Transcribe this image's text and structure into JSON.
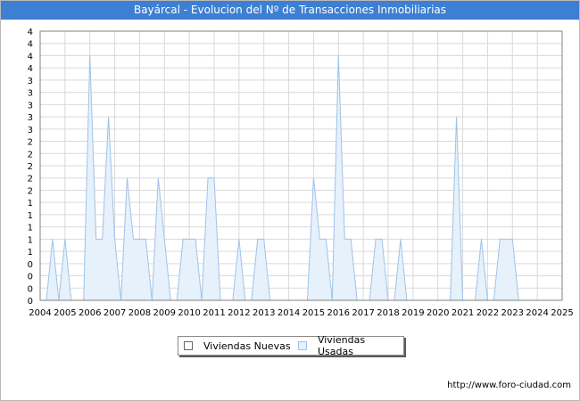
{
  "header": {
    "title": "Bayárcal - Evolucion del Nº de Transacciones Inmobiliarias"
  },
  "footer": {
    "url": "http://www.foro-ciudad.com"
  },
  "colors": {
    "title_bar": "#3d7fd3",
    "new_fill": "#ffffff",
    "used_fill": "#e6f1fb",
    "used_stroke": "#9ec3ea"
  },
  "chart_data": {
    "type": "area",
    "title": "Bayárcal - Evolucion del Nº de Transacciones Inmobiliarias",
    "xlabel": "",
    "ylabel": "",
    "x_ticks": [
      "2004",
      "2005",
      "2006",
      "2007",
      "2008",
      "2009",
      "2010",
      "2011",
      "2012",
      "2013",
      "2014",
      "2015",
      "2016",
      "2017",
      "2018",
      "2019",
      "2020",
      "2021",
      "2022",
      "2023",
      "2024",
      "2025"
    ],
    "y_tick_labels": [
      "0",
      "0",
      "0",
      "0",
      "1",
      "1",
      "1",
      "1",
      "1",
      "2",
      "2",
      "2",
      "2",
      "2",
      "3",
      "3",
      "3",
      "3",
      "3",
      "4",
      "4",
      "4",
      "4"
    ],
    "ylim": [
      0,
      4.4
    ],
    "grid": true,
    "legend_position": "bottom-center",
    "series": [
      {
        "name": "Viviendas Nuevas",
        "color": "#ffffff",
        "points": []
      },
      {
        "name": "Viviendas Usadas",
        "color": "#e6f1fb",
        "points": [
          [
            2004.0,
            0
          ],
          [
            2004.25,
            0
          ],
          [
            2004.5,
            1
          ],
          [
            2004.75,
            0
          ],
          [
            2005.0,
            1
          ],
          [
            2005.25,
            0
          ],
          [
            2005.5,
            0
          ],
          [
            2005.75,
            0
          ],
          [
            2006.0,
            4
          ],
          [
            2006.25,
            1
          ],
          [
            2006.5,
            1
          ],
          [
            2006.75,
            3
          ],
          [
            2007.0,
            1
          ],
          [
            2007.25,
            0
          ],
          [
            2007.5,
            2
          ],
          [
            2007.75,
            1
          ],
          [
            2008.0,
            1
          ],
          [
            2008.25,
            1
          ],
          [
            2008.5,
            0
          ],
          [
            2008.75,
            2
          ],
          [
            2009.0,
            1
          ],
          [
            2009.25,
            0
          ],
          [
            2009.5,
            0
          ],
          [
            2009.75,
            1
          ],
          [
            2010.0,
            1
          ],
          [
            2010.25,
            1
          ],
          [
            2010.5,
            0
          ],
          [
            2010.75,
            2
          ],
          [
            2011.0,
            2
          ],
          [
            2011.25,
            0
          ],
          [
            2011.5,
            0
          ],
          [
            2011.75,
            0
          ],
          [
            2012.0,
            1
          ],
          [
            2012.25,
            0
          ],
          [
            2012.5,
            0
          ],
          [
            2012.75,
            1
          ],
          [
            2013.0,
            1
          ],
          [
            2013.25,
            0
          ],
          [
            2013.5,
            0
          ],
          [
            2013.75,
            0
          ],
          [
            2014.0,
            0
          ],
          [
            2014.25,
            0
          ],
          [
            2014.5,
            0
          ],
          [
            2014.75,
            0
          ],
          [
            2015.0,
            2
          ],
          [
            2015.25,
            1
          ],
          [
            2015.5,
            1
          ],
          [
            2015.75,
            0
          ],
          [
            2016.0,
            4
          ],
          [
            2016.25,
            1
          ],
          [
            2016.5,
            1
          ],
          [
            2016.75,
            0
          ],
          [
            2017.0,
            0
          ],
          [
            2017.25,
            0
          ],
          [
            2017.5,
            1
          ],
          [
            2017.75,
            1
          ],
          [
            2018.0,
            0
          ],
          [
            2018.25,
            0
          ],
          [
            2018.5,
            1
          ],
          [
            2018.75,
            0
          ],
          [
            2019.0,
            0
          ],
          [
            2019.25,
            0
          ],
          [
            2019.5,
            0
          ],
          [
            2019.75,
            0
          ],
          [
            2020.0,
            0
          ],
          [
            2020.25,
            0
          ],
          [
            2020.5,
            0
          ],
          [
            2020.75,
            3
          ],
          [
            2021.0,
            0
          ],
          [
            2021.25,
            0
          ],
          [
            2021.5,
            0
          ],
          [
            2021.75,
            1
          ],
          [
            2022.0,
            0
          ],
          [
            2022.25,
            0
          ],
          [
            2022.5,
            1
          ],
          [
            2022.75,
            1
          ],
          [
            2023.0,
            1
          ],
          [
            2023.25,
            0
          ]
        ]
      }
    ]
  }
}
